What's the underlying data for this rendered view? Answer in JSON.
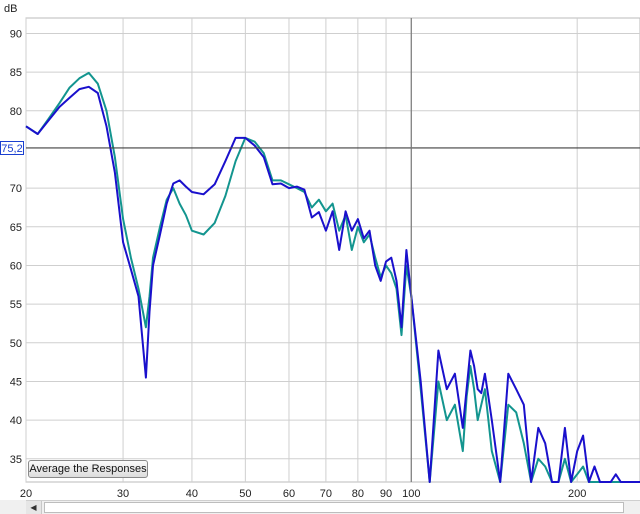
{
  "window": {
    "y_unit": "dB",
    "cursor_value": "75.2"
  },
  "buttons": {
    "average_label": "Average the Responses"
  },
  "icons": {
    "scroll_left": "triangle-left-icon"
  },
  "chart_data": {
    "type": "line",
    "xscale": "log",
    "xlim": [
      20,
      260
    ],
    "ylim": [
      32,
      92
    ],
    "ylabel": "dB",
    "cursor": {
      "x": 100,
      "y": 75.2
    },
    "x_ticks": [
      20,
      30,
      40,
      50,
      60,
      70,
      80,
      90,
      100,
      200
    ],
    "y_ticks": [
      35,
      40,
      45,
      50,
      55,
      60,
      65,
      70,
      75.2,
      80,
      85,
      90
    ],
    "y_tick_labels": [
      "35",
      "40",
      "45",
      "50",
      "55",
      "60",
      "65",
      "70",
      "75,2",
      "80",
      "85",
      "90"
    ],
    "grid": true,
    "colors": {
      "series1": "#1a10cc",
      "series2": "#13958f",
      "grid": "#cfcfcf",
      "cursor": "#404040"
    },
    "series": [
      {
        "x": [
          20,
          21,
          22,
          23,
          24,
          25,
          26,
          27,
          28,
          29,
          30,
          31,
          32,
          33,
          33.5,
          34,
          35,
          36,
          37,
          38,
          39,
          40,
          42,
          44,
          46,
          48,
          50,
          52,
          54,
          56,
          58,
          60,
          62,
          64,
          66,
          68,
          70,
          72,
          74,
          76,
          78,
          80,
          82,
          84,
          86,
          88,
          90,
          92,
          94,
          96,
          98,
          100,
          104,
          108,
          112,
          116,
          120,
          124,
          126,
          128,
          130,
          132,
          134,
          136,
          138,
          140,
          145,
          150,
          155,
          160,
          165,
          170,
          175,
          180,
          185,
          190,
          195,
          200,
          205,
          210,
          215,
          220,
          225,
          230,
          235,
          240,
          245,
          250,
          255,
          260
        ],
        "y": [
          78,
          77,
          78.8,
          80.5,
          81.7,
          82.8,
          83.1,
          82.3,
          78,
          72,
          63,
          59.5,
          56,
          45.5,
          54,
          60,
          64,
          68,
          70.6,
          71,
          70.2,
          69.5,
          69.2,
          70.5,
          73.5,
          76.5,
          76.5,
          75.5,
          74,
          70.5,
          70.6,
          70,
          70.2,
          69.8,
          66.2,
          66.9,
          64.5,
          67,
          62,
          67,
          64.5,
          66,
          63.5,
          64.5,
          60,
          58,
          60.5,
          61,
          58,
          52,
          62,
          56,
          45,
          32,
          49,
          44,
          46,
          39,
          44,
          49,
          47,
          44,
          43.5,
          46,
          43,
          40,
          32,
          46,
          44,
          42,
          32,
          39,
          37,
          32,
          32,
          39,
          32,
          36,
          38,
          32,
          34,
          31,
          32,
          31,
          33,
          31,
          31,
          30,
          30,
          30
        ]
      },
      {
        "x": [
          20,
          21,
          22,
          23,
          24,
          25,
          26,
          27,
          28,
          29,
          30,
          31,
          32,
          33,
          33.5,
          34,
          35,
          36,
          37,
          38,
          39,
          40,
          42,
          44,
          46,
          48,
          50,
          52,
          54,
          56,
          58,
          60,
          62,
          64,
          66,
          68,
          70,
          72,
          74,
          76,
          78,
          80,
          82,
          84,
          86,
          88,
          90,
          92,
          94,
          96,
          98,
          100,
          104,
          108,
          112,
          116,
          120,
          124,
          126,
          128,
          130,
          132,
          134,
          136,
          138,
          140,
          145,
          150,
          155,
          160,
          165,
          170,
          175,
          180,
          185,
          190,
          195,
          200,
          205,
          210,
          215,
          220,
          225,
          230,
          235,
          240,
          245,
          250,
          255,
          260
        ],
        "y": [
          78,
          77,
          79,
          81,
          83,
          84.2,
          84.9,
          83.5,
          80,
          74,
          66,
          61,
          57,
          52,
          56,
          61,
          65,
          68.5,
          70,
          68,
          66.5,
          64.5,
          64,
          65.5,
          69,
          73.5,
          76.5,
          76,
          74.5,
          71,
          71,
          70.5,
          70,
          69.5,
          67.5,
          68.5,
          67,
          68,
          64.5,
          66.5,
          62,
          65,
          63,
          64,
          61,
          58.5,
          60,
          59,
          57,
          51,
          60,
          56,
          44,
          32,
          45,
          40,
          42,
          36,
          43,
          47,
          44,
          40,
          42,
          44,
          40,
          36,
          30,
          42,
          41,
          37,
          30,
          35,
          34,
          30,
          30,
          35,
          30,
          33,
          34,
          30,
          31,
          30,
          30,
          30,
          30,
          30,
          30,
          30,
          30,
          30
        ]
      }
    ]
  }
}
